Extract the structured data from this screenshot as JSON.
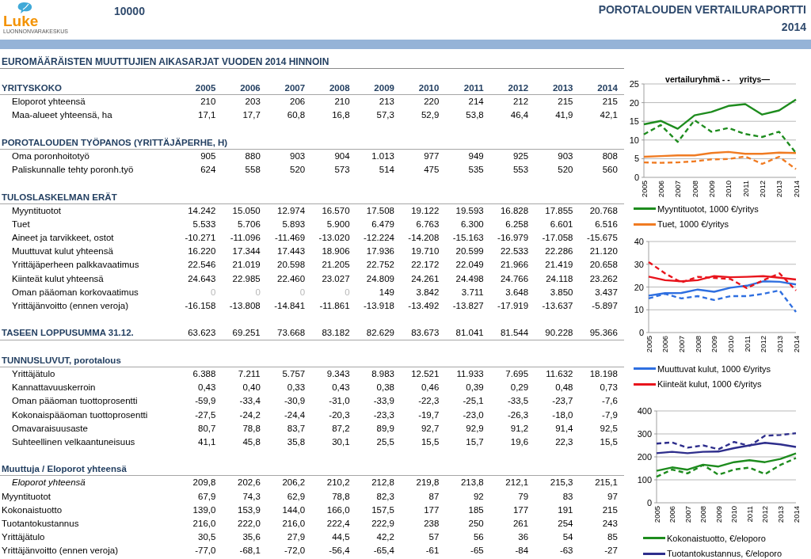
{
  "header": {
    "logo_text": "Luke",
    "logo_subtext": "LUONNONVARAKESKUS",
    "code": "10000",
    "title": "POROTALOUDEN VERTAILURAPORTTI",
    "year": "2014"
  },
  "report_title": "EUROMÄÄRÄISTEN MUUTTUJIEN AIKASARJAT VUODEN 2014 HINNOIN",
  "sections": [
    {
      "kind": "group",
      "title": "YRITYSKOKO",
      "years": [
        "2005",
        "2006",
        "2007",
        "2008",
        "2009",
        "2010",
        "2011",
        "2012",
        "2013",
        "2014"
      ],
      "rows": [
        {
          "kind": "indented",
          "label": "Eloporot yhteensä",
          "values": [
            "210",
            "203",
            "206",
            "210",
            "213",
            "220",
            "214",
            "212",
            "215",
            "215"
          ]
        },
        {
          "kind": "indented",
          "label": "Maa-alueet yhteensä, ha",
          "values": [
            "17,1",
            "17,7",
            "60,8",
            "16,8",
            "57,3",
            "52,9",
            "53,8",
            "46,4",
            "41,9",
            "42,1"
          ]
        }
      ]
    },
    {
      "kind": "group",
      "title": "POROTALOUDEN TYÖPANOS (YRITTÄJÄPERHE, H)",
      "rows": [
        {
          "kind": "indented",
          "label": "Oma poronhoitotyö",
          "values": [
            "905",
            "880",
            "903",
            "904",
            "1.013",
            "977",
            "949",
            "925",
            "903",
            "808"
          ]
        },
        {
          "kind": "indented",
          "label": "Paliskunnalle tehty poronh.työ",
          "values": [
            "624",
            "558",
            "520",
            "573",
            "514",
            "475",
            "535",
            "553",
            "520",
            "560"
          ]
        }
      ]
    },
    {
      "kind": "group",
      "title": "TULOSLASKELMAN ERÄT",
      "rows": [
        {
          "kind": "indented",
          "label": "Myyntituotot",
          "values": [
            "14.242",
            "15.050",
            "12.974",
            "16.570",
            "17.508",
            "19.122",
            "19.593",
            "16.828",
            "17.855",
            "20.768"
          ]
        },
        {
          "kind": "indented",
          "label": "Tuet",
          "values": [
            "5.533",
            "5.706",
            "5.893",
            "5.900",
            "6.479",
            "6.763",
            "6.300",
            "6.258",
            "6.601",
            "6.516"
          ]
        },
        {
          "kind": "indented",
          "label": "Aineet ja tarvikkeet, ostot",
          "values": [
            "-10.271",
            "-11.096",
            "-11.469",
            "-13.020",
            "-12.224",
            "-14.208",
            "-15.163",
            "-16.979",
            "-17.058",
            "-15.675"
          ]
        },
        {
          "kind": "indented",
          "label": "Muuttuvat kulut yhteensä",
          "values": [
            "16.220",
            "17.344",
            "17.443",
            "18.906",
            "17.936",
            "19.710",
            "20.599",
            "22.533",
            "22.286",
            "21.120"
          ]
        },
        {
          "kind": "indented",
          "label": "Yrittäjäperheen palkkavaatimus",
          "values": [
            "22.546",
            "21.019",
            "20.598",
            "21.205",
            "22.752",
            "22.172",
            "22.049",
            "21.966",
            "21.419",
            "20.658"
          ]
        },
        {
          "kind": "indented",
          "label": "Kiinteät kulut yhteensä",
          "values": [
            "24.643",
            "22.985",
            "22.460",
            "23.027",
            "24.809",
            "24.261",
            "24.498",
            "24.766",
            "24.118",
            "23.262"
          ]
        },
        {
          "kind": "indented",
          "label": "Oman pääoman korkovaatimus",
          "values": [
            "0",
            "0",
            "0",
            "0",
            "149",
            "3.842",
            "3.711",
            "3.648",
            "3.850",
            "3.437"
          ],
          "greyed": [
            true,
            true,
            true,
            true,
            false,
            false,
            false,
            false,
            false,
            false
          ]
        },
        {
          "kind": "indented",
          "label": "Yrittäjänvoitto (ennen veroja)",
          "values": [
            "-16.158",
            "-13.808",
            "-14.841",
            "-11.861",
            "-13.918",
            "-13.492",
            "-13.827",
            "-17.919",
            "-13.637",
            "-5.897"
          ]
        }
      ]
    },
    {
      "kind": "total",
      "title": "TASEEN LOPPUSUMMA 31.12.",
      "values": [
        "63.623",
        "69.251",
        "73.668",
        "83.182",
        "82.629",
        "83.673",
        "81.041",
        "81.544",
        "90.228",
        "95.366"
      ]
    },
    {
      "kind": "group",
      "title": "TUNNUSLUVUT, porotalous",
      "rows": [
        {
          "kind": "indented",
          "label": "Yrittäjätulo",
          "values": [
            "6.388",
            "7.211",
            "5.757",
            "9.343",
            "8.983",
            "12.521",
            "11.933",
            "7.695",
            "11.632",
            "18.198"
          ]
        },
        {
          "kind": "indented",
          "label": "Kannattavuuskerroin",
          "values": [
            "0,43",
            "0,40",
            "0,33",
            "0,43",
            "0,38",
            "0,46",
            "0,39",
            "0,29",
            "0,48",
            "0,73"
          ]
        },
        {
          "kind": "indented",
          "label": "Oman pääoman tuottoprosentti",
          "values": [
            "-59,9",
            "-33,4",
            "-30,9",
            "-31,0",
            "-33,9",
            "-22,3",
            "-25,1",
            "-33,5",
            "-23,7",
            "-7,6"
          ]
        },
        {
          "kind": "indented",
          "label": "Kokonaispääoman tuottoprosentti",
          "values": [
            "-27,5",
            "-24,2",
            "-24,4",
            "-20,3",
            "-23,3",
            "-19,7",
            "-23,0",
            "-26,3",
            "-18,0",
            "-7,9"
          ]
        },
        {
          "kind": "indented",
          "label": "Omavaraisuusaste",
          "values": [
            "80,7",
            "78,8",
            "83,7",
            "87,2",
            "89,9",
            "92,7",
            "92,9",
            "91,2",
            "91,4",
            "92,5"
          ]
        },
        {
          "kind": "indented",
          "label": "Suhteellinen velkaantuneisuus",
          "values": [
            "41,1",
            "45,8",
            "35,8",
            "30,1",
            "25,5",
            "15,5",
            "15,7",
            "19,6",
            "22,3",
            "15,5"
          ]
        }
      ]
    },
    {
      "kind": "group",
      "title": "Muuttuja / Eloporot yhteensä",
      "rows": [
        {
          "kind": "italic",
          "label": "Eloporot yhteensä",
          "values": [
            "209,8",
            "202,6",
            "206,2",
            "210,2",
            "212,8",
            "219,8",
            "213,8",
            "212,1",
            "215,3",
            "215,1"
          ]
        },
        {
          "kind": "plain",
          "label": "Myyntituotot",
          "values": [
            "67,9",
            "74,3",
            "62,9",
            "78,8",
            "82,3",
            "87",
            "92",
            "79",
            "83",
            "97"
          ]
        },
        {
          "kind": "plain",
          "label": "Kokonaistuotto",
          "values": [
            "139,0",
            "153,9",
            "144,0",
            "166,0",
            "157,5",
            "177",
            "185",
            "177",
            "191",
            "215"
          ]
        },
        {
          "kind": "plain",
          "label": "Tuotantokustannus",
          "values": [
            "216,0",
            "222,0",
            "216,0",
            "222,4",
            "222,9",
            "238",
            "250",
            "261",
            "254",
            "243"
          ]
        },
        {
          "kind": "plain",
          "label": "Yrittäjätulo",
          "values": [
            "30,5",
            "35,6",
            "27,9",
            "44,5",
            "42,2",
            "57",
            "56",
            "36",
            "54",
            "85"
          ]
        },
        {
          "kind": "plain",
          "label": "Yrittäjänvoitto (ennen veroja)",
          "values": [
            "-77,0",
            "-68,1",
            "-72,0",
            "-56,4",
            "-65,4",
            "-61",
            "-65",
            "-84",
            "-63",
            "-27"
          ]
        }
      ]
    }
  ],
  "charts": [
    {
      "legend": [
        {
          "label": "Myyntituotot, 1000 €/yritys",
          "color": "#1e8c1e"
        },
        {
          "label": "Tuet, 1000 €/yritys",
          "color": "#f07b22"
        }
      ],
      "chart_data": {
        "type": "line",
        "title": "vertailuryhmä - -    yritys—",
        "grid": true,
        "categories": [
          "2005",
          "2006",
          "2007",
          "2008",
          "2009",
          "2010",
          "2011",
          "2012",
          "2013",
          "2014"
        ],
        "ylim": [
          0,
          25
        ],
        "yticks": [
          0,
          5,
          10,
          15,
          20,
          25
        ],
        "series": [
          {
            "color": "#1e8c1e",
            "line_style": "solid",
            "values": [
              14.2,
              15.1,
              13.0,
              16.6,
              17.5,
              19.1,
              19.6,
              16.8,
              17.9,
              20.8
            ]
          },
          {
            "color": "#1e8c1e",
            "line_style": "dashed",
            "values": [
              11.5,
              14.0,
              9.5,
              15.3,
              12.2,
              13.2,
              11.6,
              10.8,
              12.2,
              6.5
            ]
          },
          {
            "color": "#f07b22",
            "line_style": "solid",
            "values": [
              5.5,
              5.7,
              5.9,
              5.9,
              6.5,
              6.8,
              6.3,
              6.3,
              6.6,
              6.5
            ]
          },
          {
            "color": "#f07b22",
            "line_style": "dashed",
            "values": [
              4.0,
              3.9,
              4.0,
              4.3,
              4.8,
              4.9,
              5.6,
              3.6,
              5.5,
              2.2
            ]
          }
        ]
      }
    },
    {
      "legend": [
        {
          "label": "Muuttuvat kulut, 1000 €/yritys",
          "color": "#2f6fe0"
        },
        {
          "label": "Kiinteät kulut, 1000 €/yritys",
          "color": "#e8141c"
        }
      ],
      "chart_data": {
        "type": "line",
        "grid": true,
        "categories": [
          "2005",
          "2006",
          "2007",
          "2008",
          "2009",
          "2010",
          "2011",
          "2012",
          "2013",
          "2014"
        ],
        "ylim": [
          0,
          40
        ],
        "yticks": [
          0,
          10,
          20,
          30,
          40
        ],
        "series": [
          {
            "color": "#2f6fe0",
            "line_style": "solid",
            "values": [
              16.2,
              17.3,
              17.4,
              18.9,
              17.9,
              19.7,
              20.6,
              22.5,
              22.3,
              21.1
            ]
          },
          {
            "color": "#2f6fe0",
            "line_style": "dashed",
            "values": [
              15.0,
              17.0,
              15.0,
              16.0,
              14.3,
              16.0,
              16.0,
              17.0,
              18.5,
              9.0
            ]
          },
          {
            "color": "#e8141c",
            "line_style": "solid",
            "values": [
              24.6,
              23.0,
              22.5,
              23.0,
              24.8,
              24.3,
              24.5,
              24.8,
              24.1,
              23.3
            ]
          },
          {
            "color": "#e8141c",
            "line_style": "dashed",
            "values": [
              31.0,
              26.0,
              22.0,
              24.5,
              24.0,
              23.5,
              19.5,
              23.0,
              26.0,
              18.5
            ]
          }
        ]
      }
    },
    {
      "legend": [
        {
          "label": "Kokonaistuotto, €/eloporo",
          "color": "#1e8c1e"
        },
        {
          "label": "Tuotantokustannus, €/eloporo",
          "color": "#2e2e8c"
        }
      ],
      "chart_data": {
        "type": "line",
        "grid": true,
        "categories": [
          "2005",
          "2006",
          "2007",
          "2008",
          "2009",
          "2010",
          "2011",
          "2012",
          "2013",
          "2014"
        ],
        "ylim": [
          0,
          400
        ],
        "yticks": [
          0,
          100,
          200,
          300,
          400
        ],
        "series": [
          {
            "color": "#1e8c1e",
            "line_style": "solid",
            "values": [
              139,
              154,
              144,
              166,
              158,
              177,
              185,
              177,
              191,
              215
            ]
          },
          {
            "color": "#1e8c1e",
            "line_style": "dashed",
            "values": [
              113,
              145,
              128,
              165,
              122,
              145,
              153,
              125,
              165,
              195
            ]
          },
          {
            "color": "#2e2e8c",
            "line_style": "solid",
            "values": [
              216,
              222,
              216,
              222,
              223,
              238,
              250,
              261,
              254,
              243
            ]
          },
          {
            "color": "#2e2e8c",
            "line_style": "dashed",
            "values": [
              258,
              263,
              240,
              250,
              233,
              265,
              248,
              292,
              295,
              303
            ]
          }
        ]
      }
    }
  ]
}
